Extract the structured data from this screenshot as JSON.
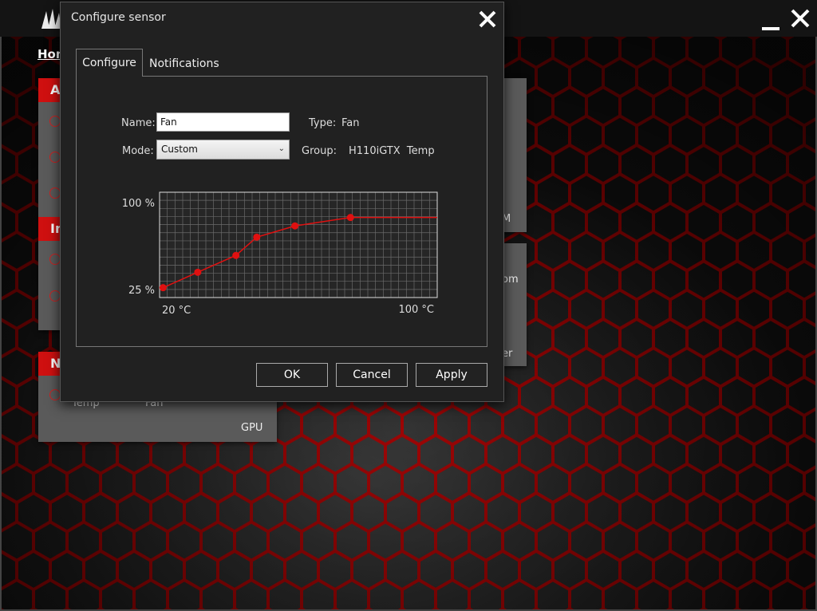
{
  "app": {
    "home_label": "Hom",
    "minimize_icon": "minimize-icon",
    "close_icon": "close-icon"
  },
  "background_panels": {
    "panel1_head": "A",
    "panel2_head": "In",
    "panel3_head": "N",
    "panel3_items": [
      "Temp",
      "Fan"
    ],
    "panel3_footer": "GPU",
    "right_panel1_text": "M",
    "right_panel2_text1": "om",
    "right_panel2_text2": "er"
  },
  "dialog": {
    "title": "Configure sensor",
    "tabs": [
      {
        "label": "Configure",
        "active": true
      },
      {
        "label": "Notifications",
        "active": false
      }
    ],
    "form": {
      "name_label": "Name:",
      "name_value": "Fan",
      "mode_label": "Mode:",
      "mode_value": "Custom",
      "type_label": "Type:",
      "type_value": "Fan",
      "group_label": "Group:",
      "group_value": "H110iGTX  Temp"
    },
    "buttons": {
      "ok": "OK",
      "cancel": "Cancel",
      "apply": "Apply"
    }
  },
  "chart_data": {
    "type": "line",
    "title": "",
    "xlabel": "",
    "ylabel": "",
    "x_tick_labels": [
      "20 °C",
      "100 °C"
    ],
    "y_tick_labels": [
      "100 %",
      "25 %"
    ],
    "xlim": [
      20,
      100
    ],
    "ylim": [
      25,
      100
    ],
    "grid": true,
    "series": [
      {
        "values_x": [
          21,
          31,
          42,
          48,
          59,
          75,
          100
        ],
        "values_y": [
          32,
          43,
          55,
          68,
          76,
          82,
          82
        ],
        "marker_count": 6,
        "color": "#e01010"
      }
    ]
  }
}
